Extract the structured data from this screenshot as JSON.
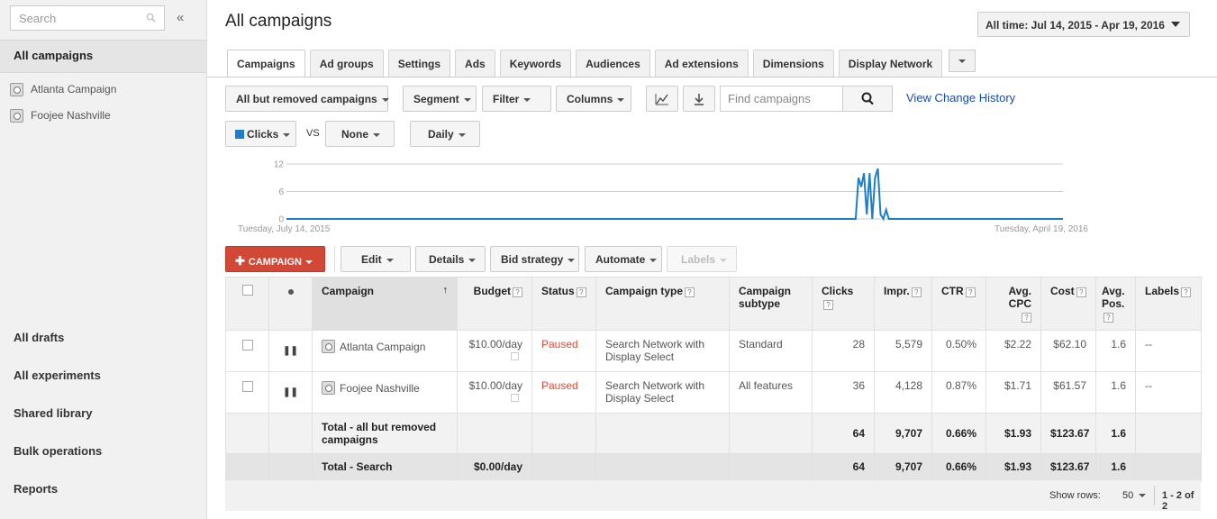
{
  "sidebar": {
    "search_placeholder": "Search",
    "collapse_label": "«",
    "all_campaigns": "All campaigns",
    "campaigns": [
      "Atlanta Campaign",
      "Foojee Nashville"
    ],
    "links": [
      "All drafts",
      "All experiments",
      "Shared library",
      "Bulk operations",
      "Reports"
    ]
  },
  "header": {
    "title": "All campaigns",
    "date_range": "All time: Jul 14, 2015 - Apr 19, 2016"
  },
  "tabs": [
    "Campaigns",
    "Ad groups",
    "Settings",
    "Ads",
    "Keywords",
    "Audiences",
    "Ad extensions",
    "Dimensions",
    "Display Network"
  ],
  "toolbar": {
    "filter_status": "All but removed campaigns",
    "segment": "Segment",
    "filter": "Filter",
    "columns": "Columns",
    "find_placeholder": "Find campaigns",
    "view_change_history": "View Change History",
    "metric1": "Clicks",
    "vs": "VS",
    "metric2": "None",
    "granularity": "Daily"
  },
  "chart_data": {
    "type": "line",
    "x_start_label": "Tuesday, July 14, 2015",
    "x_end_label": "Tuesday, April 19, 2016",
    "yticks": [
      0,
      6,
      12
    ],
    "ylim": [
      0,
      12
    ],
    "total_days": 281,
    "points": [
      [
        0,
        0
      ],
      [
        206,
        0
      ],
      [
        207,
        9
      ],
      [
        208,
        7
      ],
      [
        209,
        10
      ],
      [
        210,
        1
      ],
      [
        211,
        10
      ],
      [
        212,
        0
      ],
      [
        213,
        9
      ],
      [
        214,
        11
      ],
      [
        215,
        1
      ],
      [
        216,
        0
      ],
      [
        217,
        2
      ],
      [
        218,
        0
      ],
      [
        281,
        0
      ]
    ],
    "color": "#1c7fc8"
  },
  "actions": {
    "campaign_button": "CAMPAIGN",
    "edit": "Edit",
    "details": "Details",
    "bid_strategy": "Bid strategy",
    "automate": "Automate",
    "labels": "Labels"
  },
  "table": {
    "headers": {
      "campaign": "Campaign",
      "budget": "Budget",
      "status": "Status",
      "campaign_type": "Campaign type",
      "campaign_subtype_1": "Campaign",
      "campaign_subtype_2": "subtype",
      "clicks": "Clicks",
      "impr": "Impr.",
      "ctr": "CTR",
      "avg_cpc_1": "Avg.",
      "avg_cpc_2": "CPC",
      "cost": "Cost",
      "avg_pos_1": "Avg.",
      "avg_pos_2": "Pos.",
      "labels": "Labels"
    },
    "rows": [
      {
        "name": "Atlanta Campaign",
        "budget": "$10.00/day",
        "status": "Paused",
        "type_1": "Search Network with",
        "type_2": "Display Select",
        "subtype": "Standard",
        "clicks": "28",
        "impr": "5,579",
        "ctr": "0.50%",
        "cpc": "$2.22",
        "cost": "$62.10",
        "pos": "1.6",
        "labels": "--"
      },
      {
        "name": "Foojee Nashville",
        "budget": "$10.00/day",
        "status": "Paused",
        "type_1": "Search Network with",
        "type_2": "Display Select",
        "subtype": "All features",
        "clicks": "36",
        "impr": "4,128",
        "ctr": "0.87%",
        "cpc": "$1.71",
        "cost": "$61.57",
        "pos": "1.6",
        "labels": "--"
      }
    ],
    "total": {
      "label_1": "Total - all but removed",
      "label_2": "campaigns",
      "clicks": "64",
      "impr": "9,707",
      "ctr": "0.66%",
      "cpc": "$1.93",
      "cost": "$123.67",
      "pos": "1.6"
    },
    "grand": {
      "label": "Total - Search",
      "budget": "$0.00/day",
      "clicks": "64",
      "impr": "9,707",
      "ctr": "0.66%",
      "cpc": "$1.93",
      "cost": "$123.67",
      "pos": "1.6"
    }
  },
  "footer": {
    "show_rows": "Show rows:",
    "rows_value": "50",
    "pagination": "1 - 2 of 2"
  }
}
